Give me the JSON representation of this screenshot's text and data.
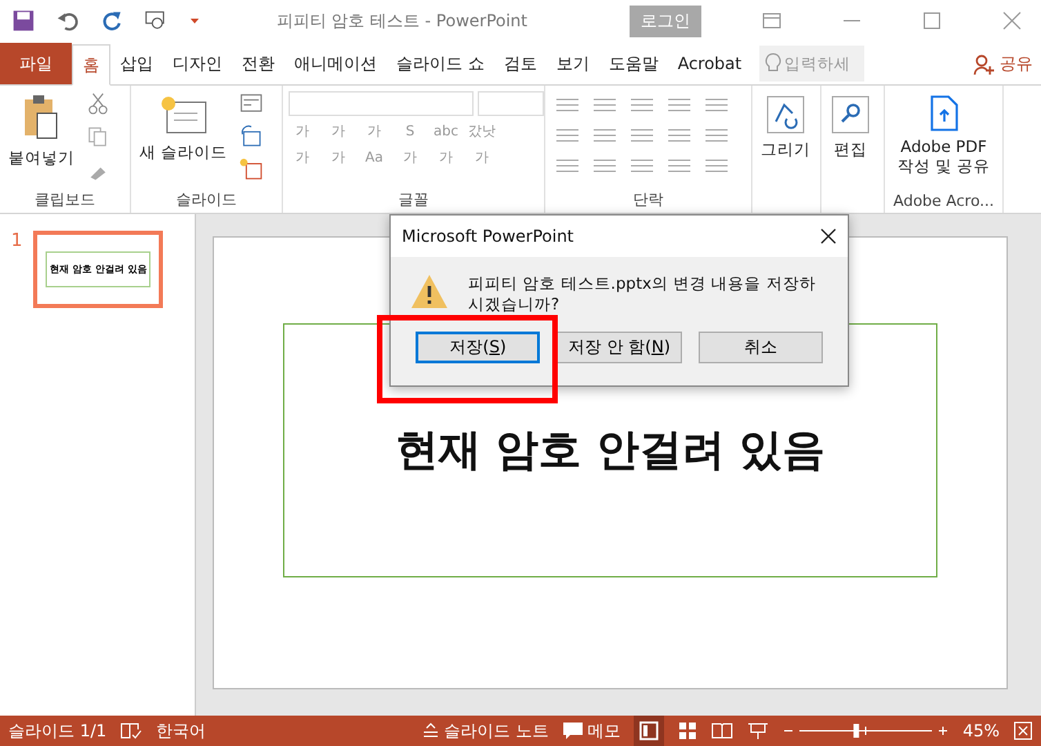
{
  "title_bar": {
    "title": "피피티 암호 테스트  -  PowerPoint",
    "login": "로그인"
  },
  "tabs": [
    {
      "label": "파일",
      "kind": "file",
      "selected": false
    },
    {
      "label": "홈",
      "kind": "tab",
      "selected": true
    },
    {
      "label": "삽입",
      "kind": "tab",
      "selected": false
    },
    {
      "label": "디자인",
      "kind": "tab",
      "selected": false
    },
    {
      "label": "전환",
      "kind": "tab",
      "selected": false
    },
    {
      "label": "애니메이션",
      "kind": "tab",
      "selected": false
    },
    {
      "label": "슬라이드 쇼",
      "kind": "tab",
      "selected": false
    },
    {
      "label": "검토",
      "kind": "tab",
      "selected": false
    },
    {
      "label": "보기",
      "kind": "tab",
      "selected": false
    },
    {
      "label": "도움말",
      "kind": "tab",
      "selected": false
    },
    {
      "label": "Acrobat",
      "kind": "tab",
      "selected": false
    }
  ],
  "search": {
    "placeholder": "입력하세"
  },
  "share": "공유",
  "ribbon": {
    "clipboard": {
      "paste": "붙여넣기",
      "label": "클립보드"
    },
    "slides": {
      "new_slide": "새 슬라이드",
      "label": "슬라이드"
    },
    "font": {
      "row_1": [
        "가",
        "가",
        "가",
        "S",
        "abc",
        "갔낫"
      ],
      "row_2": [
        "가",
        "가",
        "Aa",
        "가",
        "가",
        "가"
      ],
      "label": "글꼴"
    },
    "paragraph": {
      "label": "단락"
    },
    "drawing": {
      "button": "그리기"
    },
    "editing": {
      "button": "편집"
    },
    "adobe": {
      "button_line_1": "Adobe PDF",
      "button_line_2": "작성 및 공유",
      "label": "Adobe Acro..."
    }
  },
  "thumbnails": [
    {
      "number": "1",
      "text": "현재 암호 안걸려 있음",
      "selected": true
    }
  ],
  "slide": {
    "title": "현재 암호 안걸려 있음"
  },
  "dialog": {
    "title": "Microsoft PowerPoint",
    "message": "피피티 암호 테스트.pptx의 변경 내용을 저장하시겠습니까?",
    "buttons": [
      {
        "before": "저장(",
        "key": "S",
        "after": ")",
        "selected": true
      },
      {
        "before": "저장 안 함(",
        "key": "N",
        "after": ")",
        "selected": false
      },
      {
        "before": "취소",
        "selected": false
      }
    ]
  },
  "status_bar": {
    "slide": "슬라이드 1/1",
    "language": "한국어",
    "notes": "슬라이드 노트",
    "comments": "메모",
    "zoom": "45%",
    "zoom_slider": {
      "level": 0.45
    }
  }
}
